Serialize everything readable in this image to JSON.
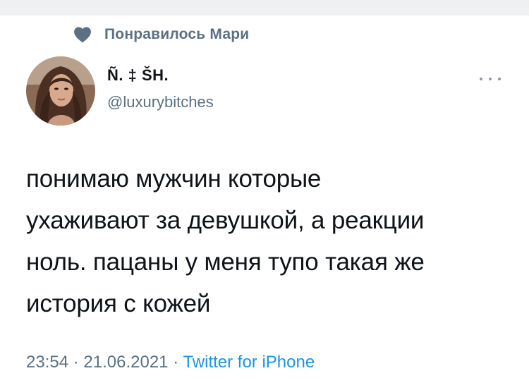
{
  "colors": {
    "text_primary": "#0f1419",
    "text_secondary": "#5b7083",
    "link": "#1b95e0",
    "background": "#ffffff"
  },
  "social_context": {
    "icon": "heart-icon",
    "text": "Понравилось Мари"
  },
  "author": {
    "display_name": "Ñ. ‡ ŠH.",
    "handle": "@luxurybitches",
    "avatar_icon": "avatar"
  },
  "more_icon": "more-options-icon",
  "tweet": {
    "lines": [
      "понимаю мужчин которые",
      "ухаживают за девушкой, а реакции",
      "ноль. пацаны у меня тупо такая же",
      "история с кожей"
    ]
  },
  "meta": {
    "time": "23:54",
    "separator": "·",
    "date": "21.06.2021",
    "source": "Twitter for iPhone"
  }
}
